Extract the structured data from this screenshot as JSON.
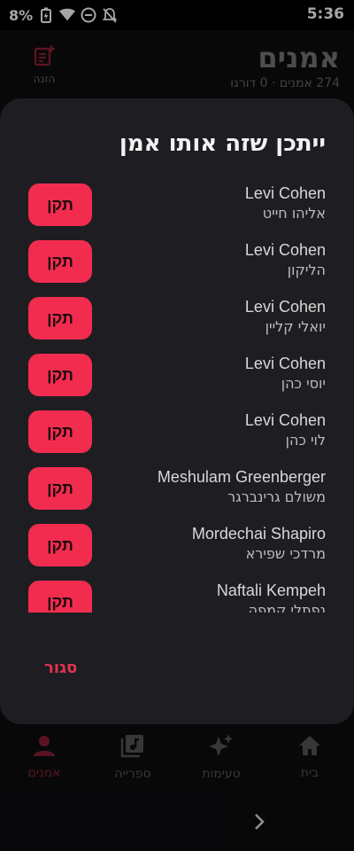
{
  "status": {
    "battery": "8%",
    "time": "5:36"
  },
  "background": {
    "title": "אמנים",
    "subtitle": "274 אמנים · 0 דורגו",
    "add_label": "הזנה",
    "nav": [
      {
        "label": "בית",
        "icon": "home-icon",
        "active": false
      },
      {
        "label": "טעימות",
        "icon": "sparkles-icon",
        "active": false
      },
      {
        "label": "ספרייה",
        "icon": "music-library-icon",
        "active": false
      },
      {
        "label": "אמנים",
        "icon": "person-icon",
        "active": true
      }
    ]
  },
  "dialog": {
    "title": "ייתכן שזה אותו אמן",
    "fix_label": "תקן",
    "close_label": "סגור",
    "items": [
      {
        "name": "Levi Cohen",
        "hebrew": "אליהו חייט"
      },
      {
        "name": "Levi Cohen",
        "hebrew": "הליקון"
      },
      {
        "name": "Levi Cohen",
        "hebrew": "יואלי קליין"
      },
      {
        "name": "Levi Cohen",
        "hebrew": "יוסי כהן"
      },
      {
        "name": "Levi Cohen",
        "hebrew": "לוי כהן"
      },
      {
        "name": "Meshulam Greenberger",
        "hebrew": "משולם גרינברגר"
      },
      {
        "name": "Mordechai Shapiro",
        "hebrew": "מרדכי שפירא"
      },
      {
        "name": "Naftali Kempeh",
        "hebrew": "נפתלי קמפה"
      }
    ]
  },
  "colors": {
    "accent": "#f22c4f",
    "dialog_bg": "#1e1e22",
    "accent_dim": "#8a2033"
  }
}
